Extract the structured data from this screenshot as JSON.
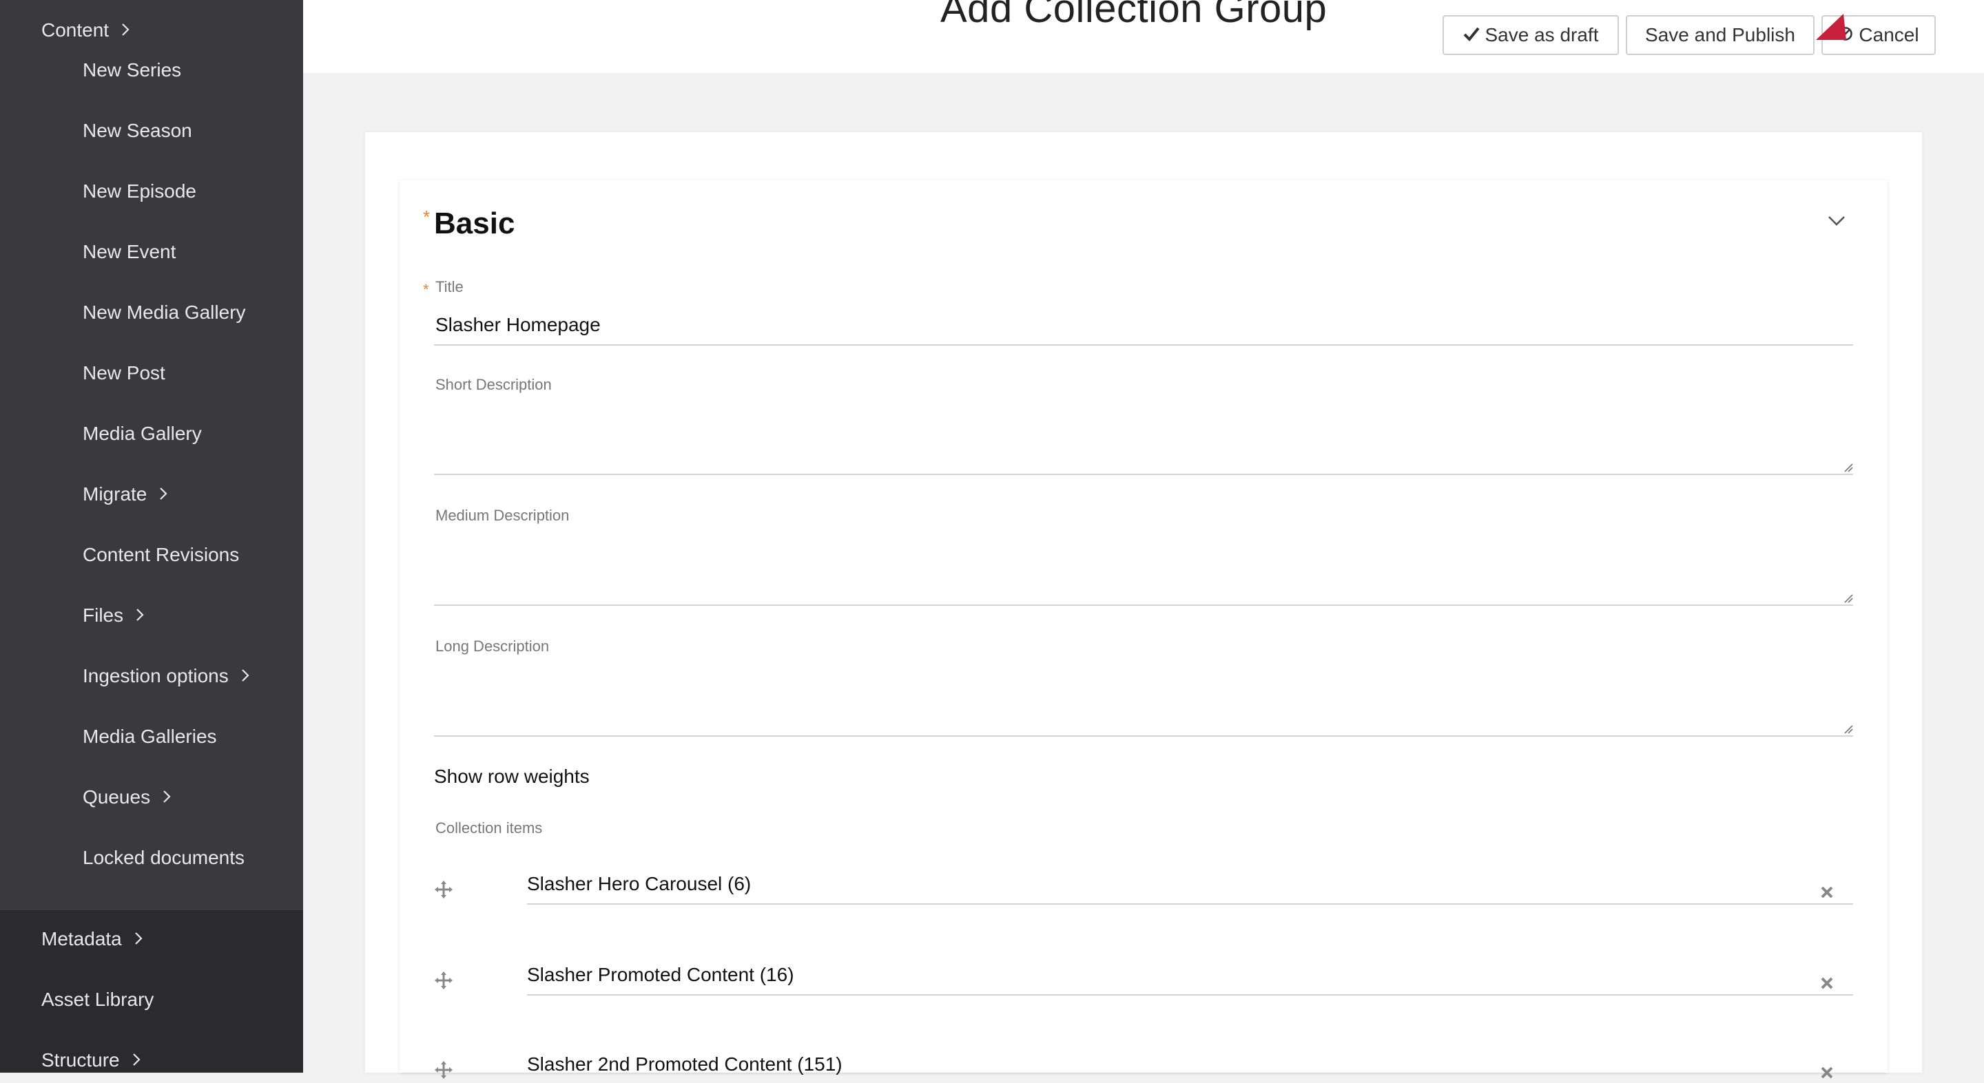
{
  "sidebar": {
    "content_label": "Content",
    "items": [
      {
        "label": "New Series",
        "chevron": false
      },
      {
        "label": "New Season",
        "chevron": false
      },
      {
        "label": "New Episode",
        "chevron": false
      },
      {
        "label": "New Event",
        "chevron": false
      },
      {
        "label": "New Media Gallery",
        "chevron": false
      },
      {
        "label": "New Post",
        "chevron": false
      },
      {
        "label": "Media Gallery",
        "chevron": false
      },
      {
        "label": "Migrate",
        "chevron": true
      },
      {
        "label": "Content Revisions",
        "chevron": false
      },
      {
        "label": "Files",
        "chevron": true
      },
      {
        "label": "Ingestion options",
        "chevron": true
      },
      {
        "label": "Media Galleries",
        "chevron": false
      },
      {
        "label": "Queues",
        "chevron": true
      },
      {
        "label": "Locked documents",
        "chevron": false
      }
    ],
    "lower_items": [
      {
        "label": "Metadata",
        "chevron": true
      },
      {
        "label": "Asset Library",
        "chevron": false
      },
      {
        "label": "Structure",
        "chevron": true
      }
    ]
  },
  "header": {
    "title": "Add Collection Group",
    "save_draft_label": "Save as draft",
    "save_publish_label": "Save and Publish",
    "cancel_label": "Cancel"
  },
  "form": {
    "section_title": "Basic",
    "title_label": "Title",
    "title_value": "Slasher Homepage",
    "short_desc_label": "Short Description",
    "medium_desc_label": "Medium Description",
    "long_desc_label": "Long Description",
    "show_weights_label": "Show row weights",
    "collection_items_label": "Collection items",
    "collection_items": [
      {
        "label": "Slasher Hero Carousel (6)"
      },
      {
        "label": "Slasher Promoted Content (16)"
      },
      {
        "label": "Slasher 2nd Promoted Content (151)"
      }
    ]
  },
  "colors": {
    "sidebar_bg": "#3a3a3c",
    "sidebar_lower_bg": "#2b2b2d",
    "required_star": "#e8852b",
    "accent_flag": "#c8203a"
  }
}
